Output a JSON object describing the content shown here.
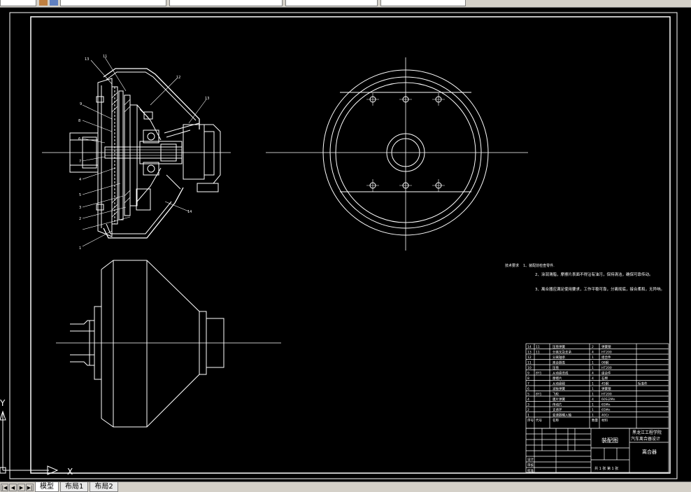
{
  "layout_tabs": [
    "模型",
    "布局1",
    "布局2"
  ],
  "part_labels": [
    "13",
    "11",
    "12",
    "13",
    "9",
    "8",
    "6",
    "7",
    "4",
    "5",
    "3",
    "2",
    "1",
    "14"
  ],
  "tech_requirements": {
    "title": "技术要求",
    "items": [
      "1、装配前检查零件.",
      "2、涂润滑脂，摩擦片表面不得沾有油污，保持清洁，确保可靠传动。",
      "3、离合器应满足使用要求，工作平稳可靠，分离彻底，接合柔和，无异响。"
    ]
  },
  "parts_table": {
    "rows": [
      [
        "14",
        "11",
        "压盘弹簧",
        "2",
        "弹簧钢"
      ],
      [
        "13",
        "11",
        "分离叉及支承",
        "4",
        "HT200"
      ],
      [
        "12",
        "",
        "分离轴承",
        "1",
        "组合件"
      ],
      [
        "11",
        "",
        "离合器盖",
        "1",
        "08钢"
      ],
      [
        "10",
        "",
        "压盘",
        "1",
        "HT200"
      ],
      [
        "9",
        "8Y1",
        "从动盘总成",
        "4",
        "组合件"
      ],
      [
        "8",
        "",
        "摩擦片",
        "4",
        "石棉"
      ],
      [
        "7",
        "",
        "从动盘毂",
        "1",
        "45钢"
      ],
      [
        "6",
        "",
        "减振弹簧",
        "1",
        "弹簧钢"
      ],
      [
        "5",
        "8Y1",
        "飞轮",
        "1",
        "HT200"
      ],
      [
        "4",
        "",
        "膜片弹簧",
        "4",
        "60Si2Mn"
      ],
      [
        "3",
        "",
        "传动片",
        "1",
        "65Mn"
      ],
      [
        "2",
        "",
        "支承环",
        "1",
        "65Mn"
      ],
      [
        "1",
        "",
        "变速器输入轴",
        "1",
        "40Cr"
      ]
    ],
    "header": [
      "序号",
      "代号",
      "名称",
      "数量",
      "材料"
    ],
    "remark": "标准件"
  },
  "title_block": {
    "school": "黑龙江工程学院",
    "drawing_name": "汽车离合器设计",
    "part": "离合器",
    "label_assembly": "装配图",
    "sheet": "共 1 张  第 1 张",
    "row_labels": [
      "设计",
      "审核",
      "批准"
    ]
  },
  "ucs": {
    "x_label": "X",
    "y_label": "Y"
  }
}
